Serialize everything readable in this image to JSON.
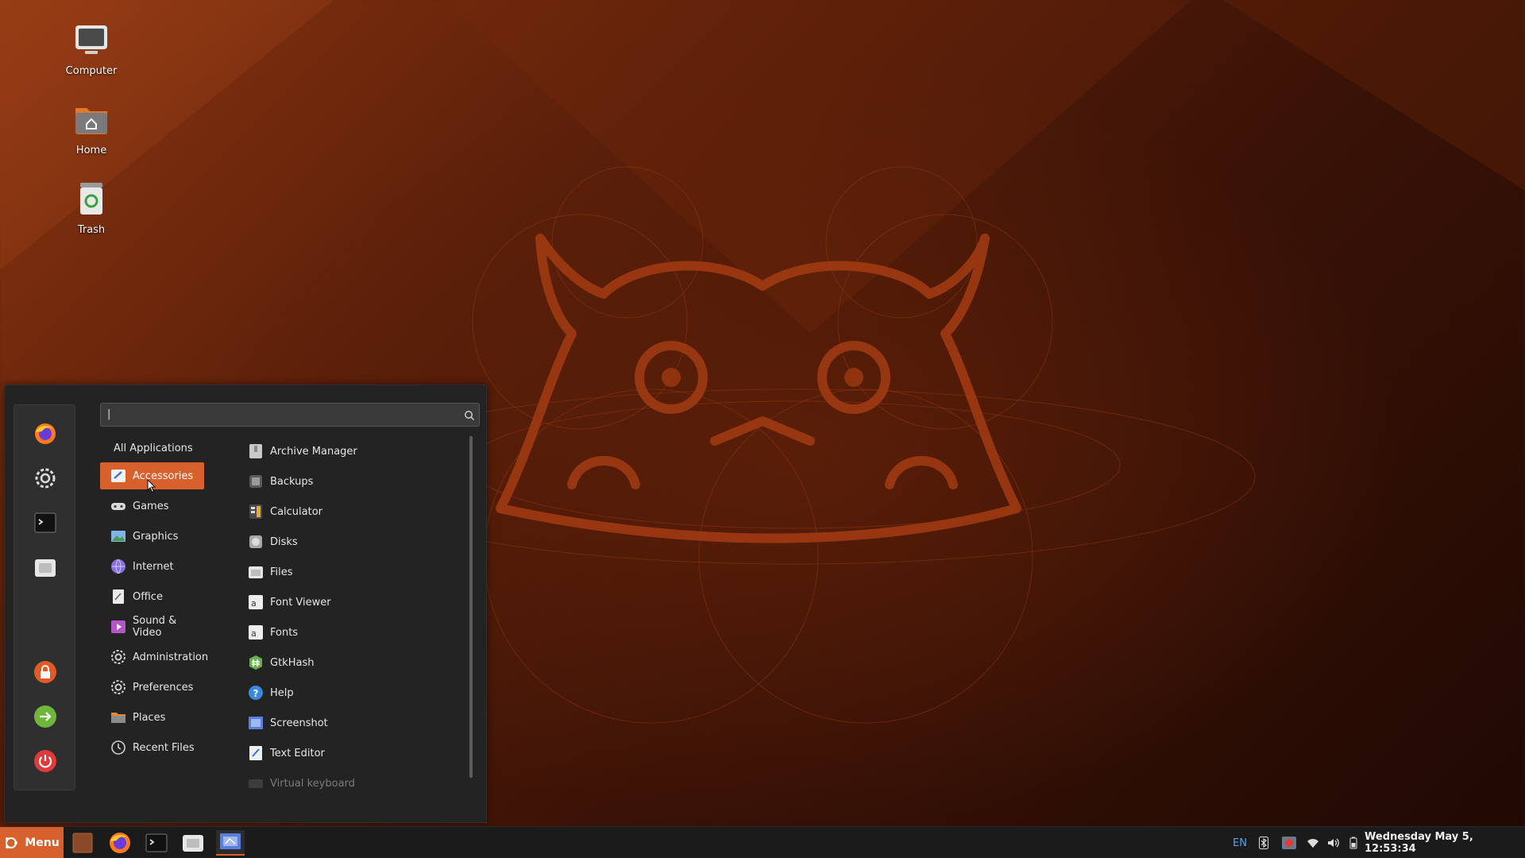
{
  "desktop": {
    "icons": [
      {
        "label": "Computer"
      },
      {
        "label": "Home"
      },
      {
        "label": "Trash"
      }
    ]
  },
  "menu": {
    "search": {
      "value": "|"
    },
    "categories": [
      {
        "label": "All Applications"
      },
      {
        "label": "Accessories",
        "selected": true
      },
      {
        "label": "Games"
      },
      {
        "label": "Graphics"
      },
      {
        "label": "Internet"
      },
      {
        "label": "Office"
      },
      {
        "label": "Sound & Video"
      },
      {
        "label": "Administration"
      },
      {
        "label": "Preferences"
      },
      {
        "label": "Places"
      },
      {
        "label": "Recent Files"
      }
    ],
    "apps": [
      {
        "label": "Archive Manager"
      },
      {
        "label": "Backups"
      },
      {
        "label": "Calculator"
      },
      {
        "label": "Disks"
      },
      {
        "label": "Files"
      },
      {
        "label": "Font Viewer"
      },
      {
        "label": "Fonts"
      },
      {
        "label": "GtkHash"
      },
      {
        "label": "Help"
      },
      {
        "label": "Screenshot"
      },
      {
        "label": "Text Editor"
      },
      {
        "label": "Virtual keyboard"
      }
    ]
  },
  "taskbar": {
    "menu_label": "Menu",
    "keyboard_layout": "EN",
    "clock": "Wednesday May  5, 12:53:34"
  },
  "colors": {
    "accent": "#d8602c",
    "panel": "#232323",
    "taskbar": "#1b1b1b"
  }
}
